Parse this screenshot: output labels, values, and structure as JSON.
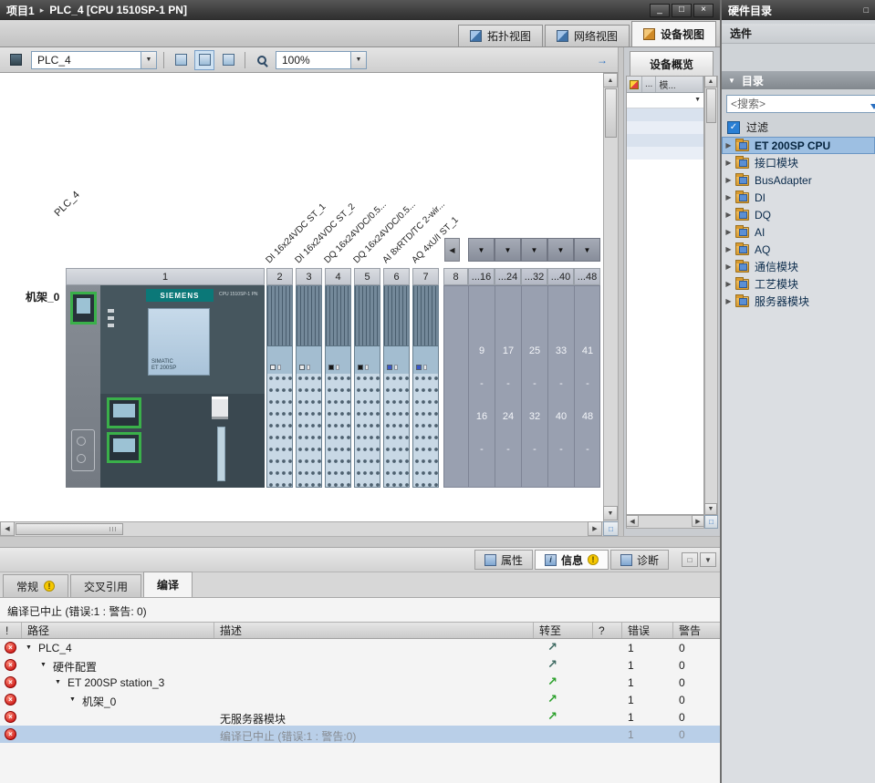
{
  "title_bar": {
    "project": "项目1",
    "separator": "▸",
    "title": "PLC_4 [CPU 1510SP-1 PN]"
  },
  "icons": {
    "minimize": "_",
    "restore": "□",
    "close": "×",
    "down": "▼",
    "up": "▲",
    "left": "◀",
    "right": "▶",
    "expand": "▶",
    "collapse": "▼",
    "goto": "↗",
    "error": "×",
    "check": "✓",
    "pin": "□",
    "info": "i",
    "warn": "!"
  },
  "view_tabs": {
    "topology": "拓扑视图",
    "network": "网络视图",
    "device": "设备视图"
  },
  "toolbar": {
    "device": "PLC_4",
    "zoom": "100%"
  },
  "canvas": {
    "plc_label": "PLC_4",
    "rack_label": "机架_0",
    "slots": [
      "1",
      "2",
      "3",
      "4",
      "5",
      "6",
      "7",
      "8"
    ],
    "module_labels": [
      "DI 16x24VDC ST_1",
      "DI 16x24VDC ST_2",
      "DQ 16x24VDC/0.5...",
      "DQ 16x24VDC/0.5...",
      "AI 8xRTD/TC 2-wir...",
      "AQ 4xU/I ST_1"
    ],
    "cpu": {
      "brand": "SIEMENS",
      "model": "CPU 1510SP-1 PN",
      "screen1": "SIMATIC",
      "screen2": "ET 200SP"
    },
    "overview_headers": [
      "...16",
      "...24",
      "...32",
      "...40",
      "...48"
    ],
    "overview_tops": [
      "9",
      "17",
      "25",
      "33",
      "41"
    ],
    "overview_bottoms": [
      "16",
      "24",
      "32",
      "40",
      "48"
    ],
    "dash": "-"
  },
  "device_overview": {
    "tab": "设备概览",
    "col_dots": "...",
    "col_module": "模..."
  },
  "catalog": {
    "header": "硬件目录",
    "options": "选件",
    "catalog": "目录",
    "search_placeholder": "<搜索>",
    "filter": "过滤",
    "items": [
      {
        "label": "ET 200SP CPU",
        "selected": true
      },
      {
        "label": "接口模块"
      },
      {
        "label": "BusAdapter"
      },
      {
        "label": "DI"
      },
      {
        "label": "DQ"
      },
      {
        "label": "AI"
      },
      {
        "label": "AQ"
      },
      {
        "label": "通信模块"
      },
      {
        "label": "工艺模块"
      },
      {
        "label": "服务器模块"
      }
    ]
  },
  "inspector": {
    "panel_tabs": {
      "properties": "属性",
      "info": "信息",
      "diagnostics": "诊断"
    },
    "tabs": {
      "general": "常规",
      "crossref": "交叉引用",
      "compile": "编译"
    },
    "status": "编译已中止 (错误:1 : 警告: 0)",
    "columns": {
      "bang": "!",
      "path": "路径",
      "desc": "描述",
      "goto": "转至",
      "q": "?",
      "errors": "错误",
      "warnings": "警告"
    },
    "rows": [
      {
        "path": "PLC_4",
        "desc": "",
        "errors": "1",
        "warnings": "0"
      },
      {
        "path": "硬件配置",
        "desc": "",
        "errors": "1",
        "warnings": "0"
      },
      {
        "path": "ET 200SP station_3",
        "desc": "",
        "errors": "1",
        "warnings": "0"
      },
      {
        "path": "机架_0",
        "desc": "",
        "errors": "1",
        "warnings": "0"
      },
      {
        "path": "",
        "desc": "无服务器模块",
        "errors": "1",
        "warnings": "0"
      },
      {
        "path": "",
        "desc": "编译已中止 (错误:1 : 警告:0)",
        "errors": "1",
        "warnings": "0"
      }
    ]
  },
  "colors": {
    "selection": "#9dbfe2",
    "error": "#c20000",
    "success": "#2aa02a",
    "warning": "#f6c800",
    "accent": "#2a7fd4",
    "cpu_body": "#46565e",
    "io_module": "#a3bdd0"
  }
}
